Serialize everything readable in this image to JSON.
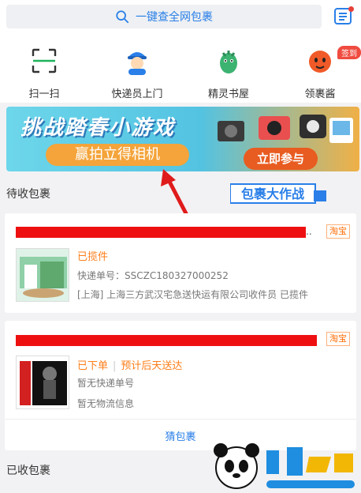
{
  "header": {
    "search_text": "一键查全网包裹"
  },
  "quicknav": [
    {
      "label": "扫一扫",
      "icon": "scan-icon"
    },
    {
      "label": "快递员上门",
      "icon": "courier-icon"
    },
    {
      "label": "精灵书屋",
      "icon": "dinosaur-icon"
    },
    {
      "label": "领裹酱",
      "icon": "mascot-icon"
    }
  ],
  "signin_badge": "签到",
  "banner": {
    "title": "挑战踏春小游戏",
    "subtitle": "赢拍立得相机",
    "cta": "立即参与"
  },
  "pending": {
    "heading": "待收包裹",
    "promo_logo": "包裹大作战",
    "packages": [
      {
        "source": "淘宝",
        "status": "已揽件",
        "tracking": "快递单号：SSCZC180327000252",
        "logistics": "[上海] 上海三方武汉宅急送快运有限公司收件员 已揽件"
      },
      {
        "source": "淘宝",
        "status": "已下单",
        "eta": "预计后天送达",
        "tracking": "暂无快递单号",
        "logistics": "暂无物流信息"
      }
    ],
    "track_button": "猜包裹"
  },
  "received": {
    "heading": "已收包裹"
  },
  "colors": {
    "accent": "#2a7fe8",
    "status": "#ff7e1a",
    "redaction": "#ee1010"
  }
}
